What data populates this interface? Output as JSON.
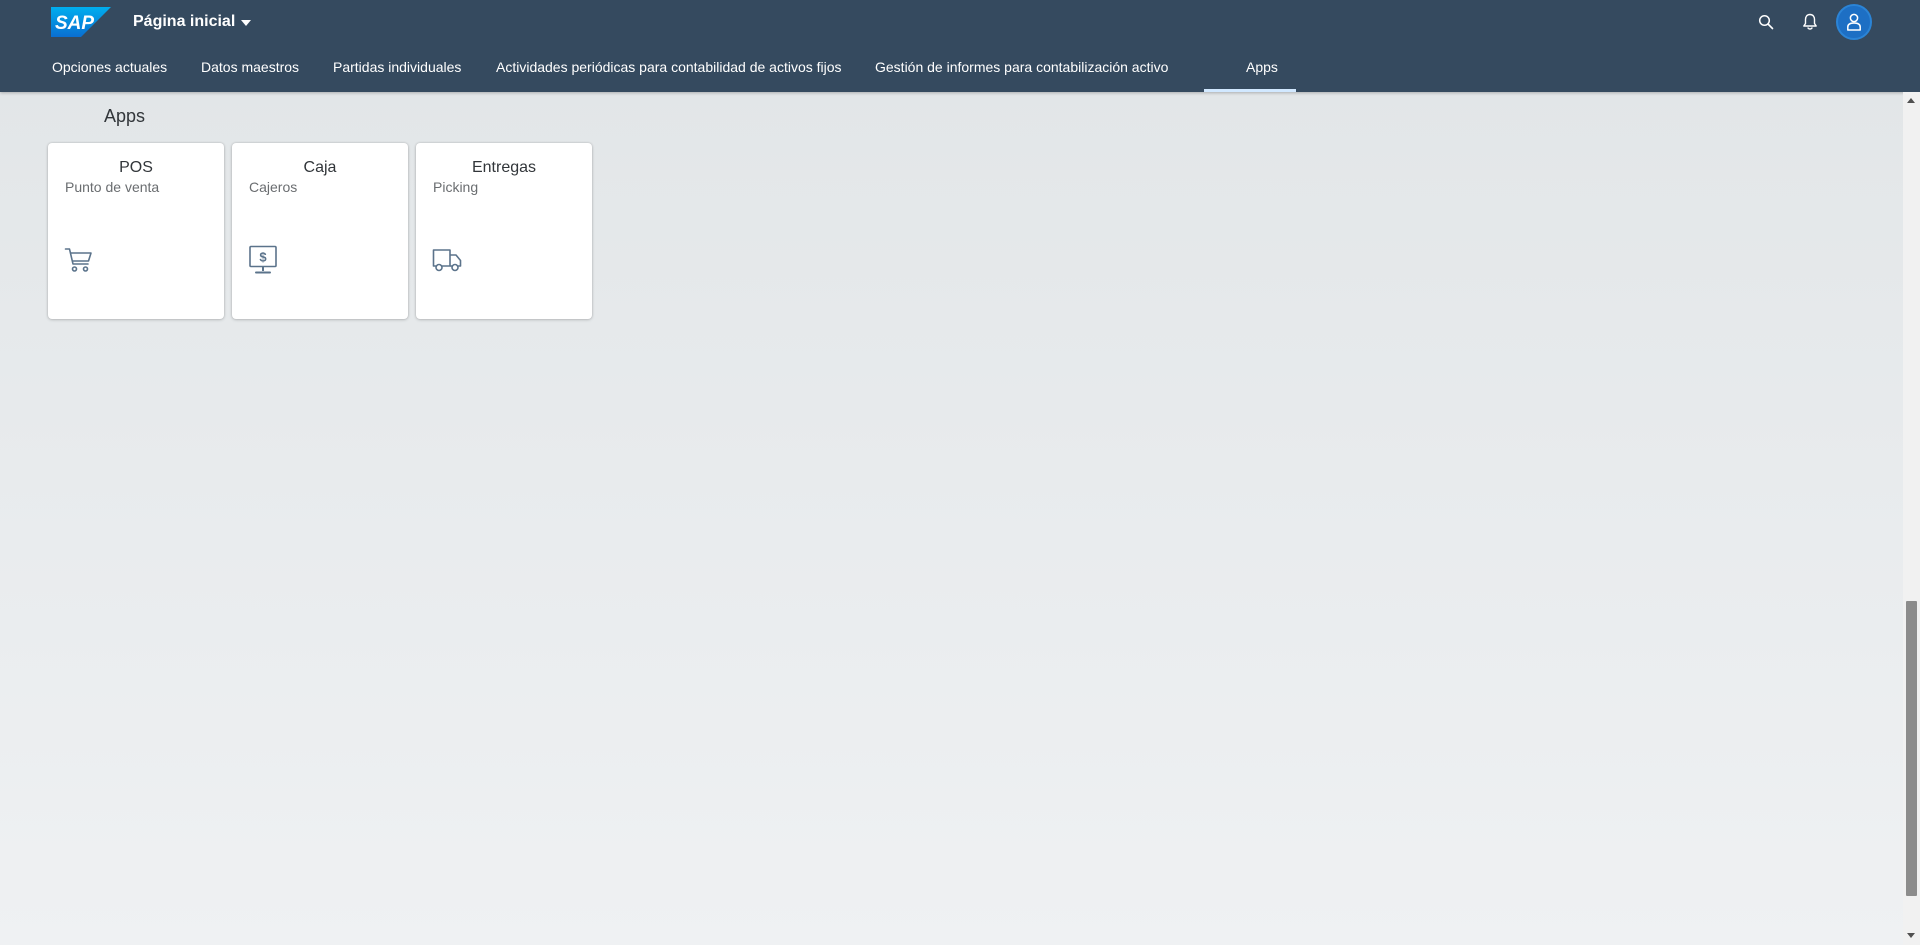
{
  "shell": {
    "logo_text": "SAP",
    "title": "Página inicial",
    "icons": {
      "search": "search-icon",
      "notifications": "bell-icon",
      "user": "user-icon"
    },
    "colors": {
      "header_bg": "#354a5f",
      "avatar_bg": "#1d6fc4",
      "logo_blue": "#0a6ed1",
      "active_tab_underline": "#d1e8ff"
    }
  },
  "tabs": [
    {
      "label": "Opciones actuales"
    },
    {
      "label": "Datos maestros"
    },
    {
      "label": "Partidas individuales"
    },
    {
      "label": "Actividades periódicas para contabilidad de activos fijos"
    },
    {
      "label": "Gestión de informes para contabilización activo"
    },
    {
      "label": "Apps",
      "active": true
    }
  ],
  "section": {
    "title": "Apps"
  },
  "tiles": [
    {
      "title": "POS",
      "subtitle": "Punto de venta",
      "icon": "cart-icon"
    },
    {
      "title": "Caja",
      "subtitle": "Cajeros",
      "icon": "cashier-monitor-icon"
    },
    {
      "title": "Entregas",
      "subtitle": "Picking",
      "icon": "truck-icon"
    }
  ]
}
